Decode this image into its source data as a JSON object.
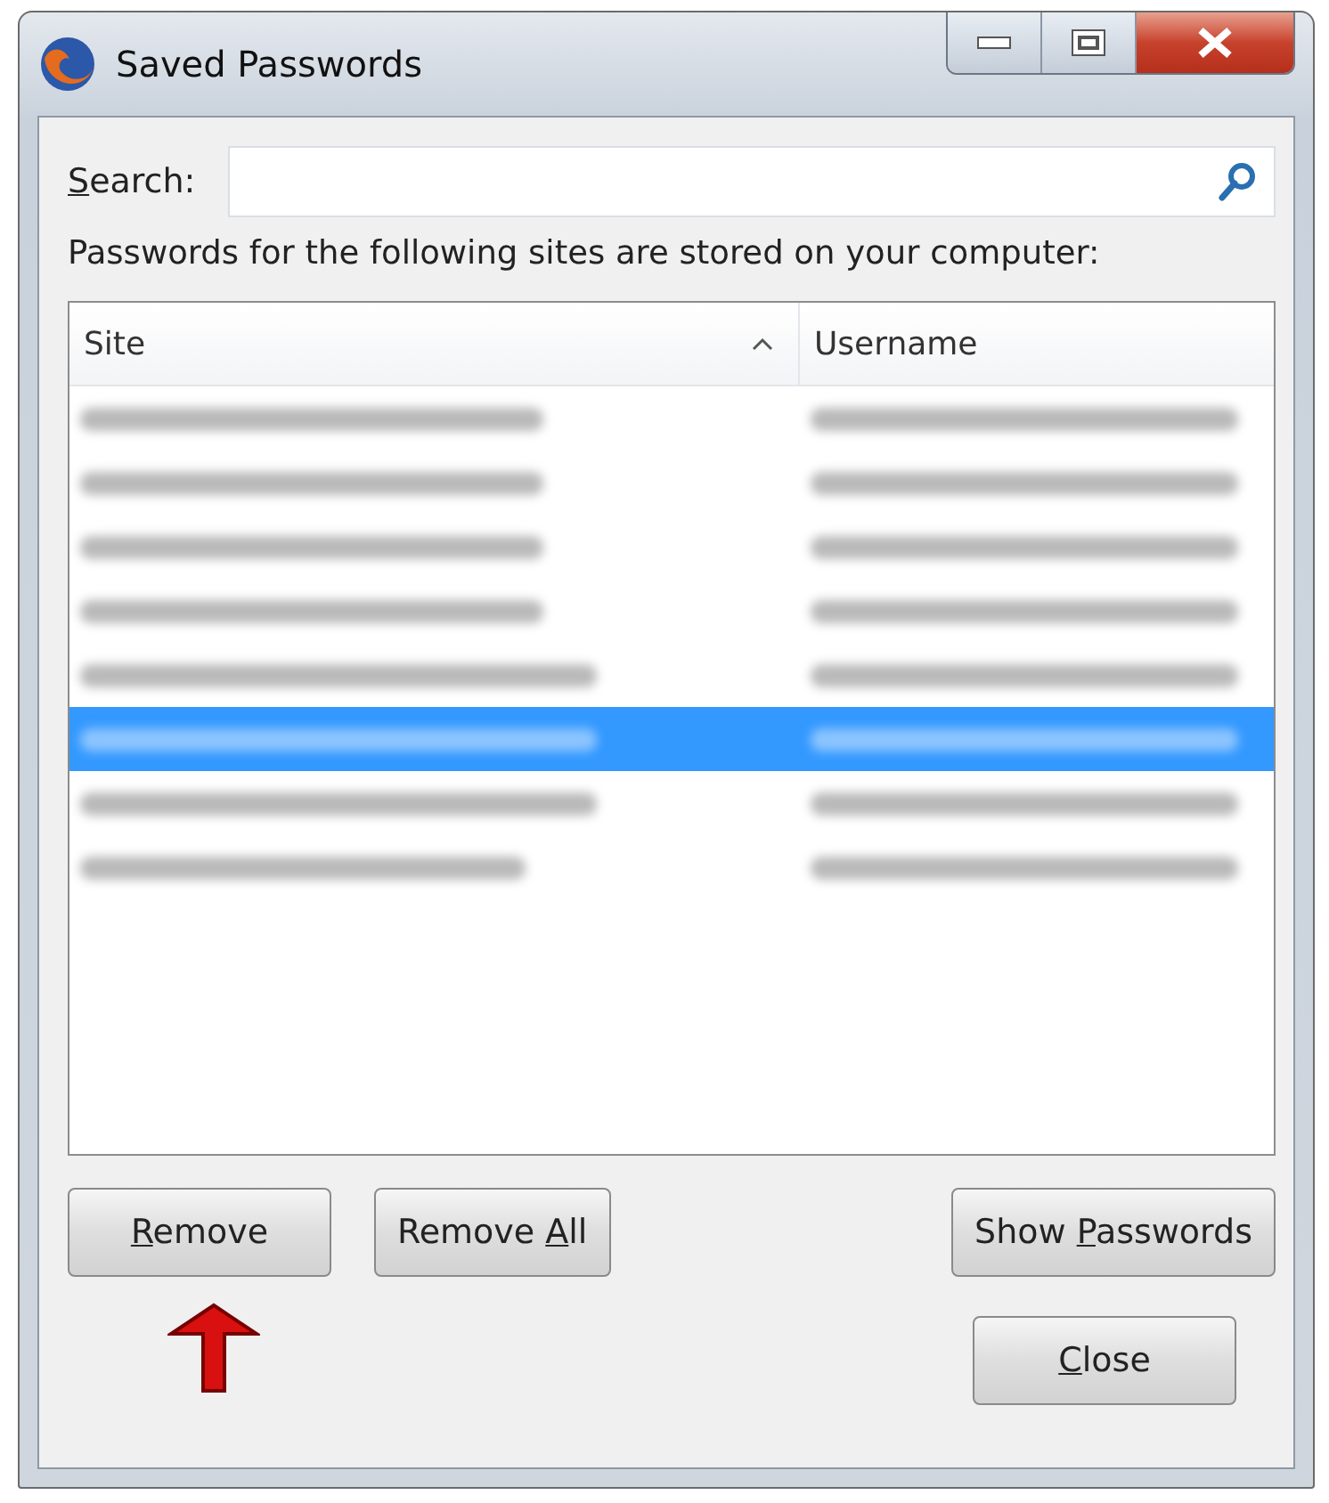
{
  "window": {
    "title": "Saved Passwords"
  },
  "search": {
    "label": {
      "key": "S",
      "after": "earch:"
    }
  },
  "description": "Passwords for the following sites are stored on your computer:",
  "table": {
    "columns": [
      {
        "label": "Site",
        "sorted": true
      },
      {
        "label": "Username",
        "sorted": false
      }
    ],
    "rows": [
      {
        "selected": false
      },
      {
        "selected": false
      },
      {
        "selected": false
      },
      {
        "selected": false
      },
      {
        "selected": false
      },
      {
        "selected": true
      },
      {
        "selected": false
      },
      {
        "selected": false
      }
    ]
  },
  "buttons": [
    {
      "label": {
        "key": "R",
        "after": "emove"
      }
    },
    {
      "label": {
        "before": "Remove ",
        "key": "A",
        "after": "ll"
      }
    },
    {
      "label": {
        "before": "Show ",
        "key": "P",
        "after": "asswords"
      }
    }
  ],
  "close_button": {
    "label": {
      "key": "C",
      "after": "lose"
    }
  }
}
